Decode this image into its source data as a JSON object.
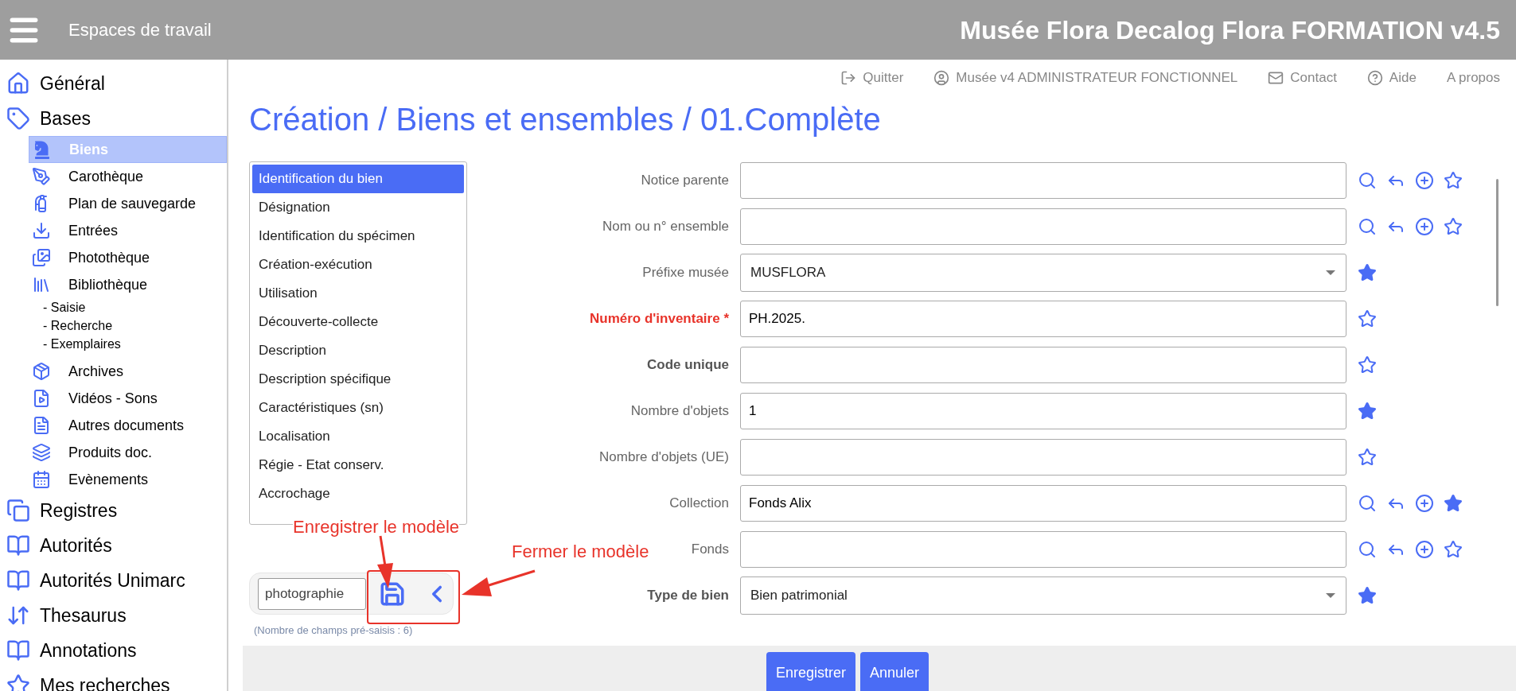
{
  "header": {
    "workspace_label": "Espaces de travail",
    "app_title": "Musée Flora Decalog Flora FORMATION v4.5"
  },
  "top_links": [
    {
      "label": "Quitter"
    },
    {
      "label": "Musée v4 ADMINISTRATEUR FONCTIONNEL"
    },
    {
      "label": "Contact"
    },
    {
      "label": "Aide"
    },
    {
      "label": "A propos"
    }
  ],
  "sidebar": {
    "items": [
      {
        "label": "Général",
        "selected": false
      },
      {
        "label": "Bases",
        "selected": false,
        "children": [
          {
            "label": "Biens",
            "selected": true
          },
          {
            "label": "Carothèque",
            "selected": false
          },
          {
            "label": "Plan de sauvegarde",
            "selected": false
          },
          {
            "label": "Entrées",
            "selected": false
          },
          {
            "label": "Photothèque",
            "selected": false
          },
          {
            "label": "Bibliothèque",
            "selected": false,
            "children": [
              {
                "label": "- Saisie",
                "selected": false
              },
              {
                "label": "- Recherche",
                "selected": false
              },
              {
                "label": "- Exemplaires",
                "selected": false
              }
            ]
          },
          {
            "label": "Archives",
            "selected": false
          },
          {
            "label": "Vidéos - Sons",
            "selected": false
          },
          {
            "label": "Autres documents",
            "selected": false
          },
          {
            "label": "Produits doc.",
            "selected": false
          },
          {
            "label": "Evènements",
            "selected": false
          }
        ]
      },
      {
        "label": "Registres",
        "selected": false
      },
      {
        "label": "Autorités",
        "selected": false
      },
      {
        "label": "Autorités Unimarc",
        "selected": false
      },
      {
        "label": "Thesaurus",
        "selected": false
      },
      {
        "label": "Annotations",
        "selected": false
      },
      {
        "label": "Mes recherches",
        "selected": false
      }
    ]
  },
  "page_title": "Création / Biens et ensembles / 01.Complète",
  "sections": [
    {
      "label": "Identification du bien",
      "selected": true
    },
    {
      "label": "Désignation",
      "selected": false
    },
    {
      "label": "Identification du spécimen",
      "selected": false
    },
    {
      "label": "Création-exécution",
      "selected": false
    },
    {
      "label": "Utilisation",
      "selected": false
    },
    {
      "label": "Découverte-collecte",
      "selected": false
    },
    {
      "label": "Description",
      "selected": false
    },
    {
      "label": "Description spécifique",
      "selected": false
    },
    {
      "label": "Caractéristiques (sn)",
      "selected": false
    },
    {
      "label": "Localisation",
      "selected": false
    },
    {
      "label": "Régie - Etat conserv.",
      "selected": false
    },
    {
      "label": "Accrochage",
      "selected": false
    }
  ],
  "template": {
    "value": "photographie",
    "note": "(Nombre de champs pré-saisis : 6)"
  },
  "fields": [
    {
      "label": "Notice parente",
      "required": false,
      "bold": false,
      "kind": "text",
      "lookup": true,
      "favorite": false
    },
    {
      "label": "Nom ou n° ensemble",
      "required": false,
      "bold": false,
      "kind": "text",
      "lookup": true,
      "favorite": false
    },
    {
      "label": "Préfixe musée",
      "required": false,
      "bold": false,
      "kind": "select",
      "value": "MUSFLORA",
      "lookup": false,
      "favorite": true
    },
    {
      "label": "Numéro d'inventaire *",
      "required": true,
      "bold": true,
      "kind": "text",
      "value": "PH.2025.",
      "lookup": false,
      "favorite": false
    },
    {
      "label": "Code unique",
      "required": false,
      "bold": true,
      "kind": "text",
      "lookup": false,
      "favorite": false
    },
    {
      "label": "Nombre d'objets",
      "required": false,
      "bold": false,
      "kind": "text",
      "value": "1",
      "lookup": false,
      "favorite": true
    },
    {
      "label": "Nombre d'objets (UE)",
      "required": false,
      "bold": false,
      "kind": "text",
      "lookup": false,
      "favorite": false
    },
    {
      "label": "Collection",
      "required": false,
      "bold": false,
      "kind": "text",
      "value": "Fonds Alix",
      "lookup": true,
      "favorite": true
    },
    {
      "label": "Fonds",
      "required": false,
      "bold": false,
      "kind": "text",
      "lookup": true,
      "favorite": false
    },
    {
      "label": "Type de bien",
      "required": false,
      "bold": true,
      "kind": "select",
      "value": "Bien patrimonial",
      "lookup": false,
      "favorite": true
    }
  ],
  "buttons": [
    {
      "label": "Enregistrer"
    },
    {
      "label": "Annuler"
    }
  ],
  "annotations": [
    {
      "text": "Enregistrer le modèle"
    },
    {
      "text": "Fermer le modèle"
    }
  ]
}
